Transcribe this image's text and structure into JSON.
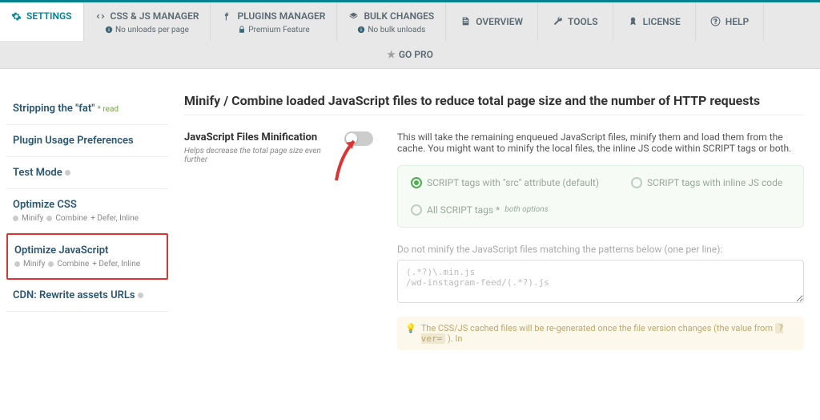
{
  "tabs": {
    "settings": {
      "label": "SETTINGS"
    },
    "cssjs": {
      "label": "CSS & JS MANAGER",
      "sub": "No unloads per page"
    },
    "plugins": {
      "label": "PLUGINS MANAGER",
      "sub": "Premium Feature"
    },
    "bulk": {
      "label": "BULK CHANGES",
      "sub": "No bulk unloads"
    },
    "overview": {
      "label": "OVERVIEW"
    },
    "tools": {
      "label": "TOOLS"
    },
    "license": {
      "label": "LICENSE"
    },
    "help": {
      "label": "HELP"
    }
  },
  "gopro": "GO PRO",
  "sidebar": {
    "strip": {
      "title": "Stripping the \"fat\"",
      "read": "* read"
    },
    "plugin_prefs": {
      "title": "Plugin Usage Preferences"
    },
    "test_mode": {
      "title": "Test Mode"
    },
    "optimize_css": {
      "title": "Optimize CSS",
      "sub_minify": "Minify",
      "sub_combine": "Combine",
      "sub_extra": "+ Defer, Inline"
    },
    "optimize_js": {
      "title": "Optimize JavaScript",
      "sub_minify": "Minify",
      "sub_combine": "Combine",
      "sub_extra": "+ Defer, Inline"
    },
    "cdn": {
      "title": "CDN: Rewrite assets URLs"
    }
  },
  "main": {
    "heading": "Minify / Combine loaded JavaScript files to reduce total page size and the number of HTTP requests",
    "setting_label": "JavaScript Files Minification",
    "setting_help": "Helps decrease the total page size even further",
    "setting_desc": "This will take the remaining enqueued JavaScript files, minify them and load them from the cache. You might want to minify the local files, the inline JS code within SCRIPT tags or both.",
    "opt1": "SCRIPT tags with \"src\" attribute (default)",
    "opt2": "SCRIPT tags with inline JS code",
    "opt3": "All SCRIPT tags *",
    "opt3_note": "both options",
    "exclude_label": "Do not minify the JavaScript files matching the patterns below (one per line):",
    "exclude_value": "(.*?)\\.min.js\n/wd-instagram-feed/(.*?).js",
    "note_pre": "The CSS/JS cached files will be re-generated once the file version changes (the value from",
    "note_tag": "?ver=",
    "note_post": "). In"
  }
}
